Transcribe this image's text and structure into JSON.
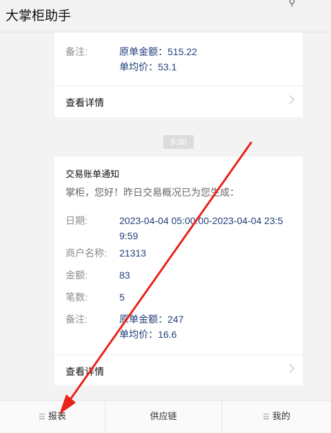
{
  "header": {
    "title": "大掌柜助手",
    "pin_icon": "pin-icon"
  },
  "first_card": {
    "note_label": "备注:",
    "note_lines": [
      "原单金额：515.22",
      "单均价：53.1"
    ],
    "detail_label": "查看详情"
  },
  "timestamp": "9:30",
  "second_card": {
    "title": "交易账单通知",
    "greeting": "掌柜，您好！昨日交易概况已为您生成：",
    "fields": [
      {
        "label": "日期:",
        "value": "2023-04-04 05:00:00-2023-04-04 23:5\n9:59"
      },
      {
        "label": "商户名称:",
        "value": "21313"
      },
      {
        "label": "金额:",
        "value": "83"
      },
      {
        "label": "笔数:",
        "value": "5"
      },
      {
        "label": "备注:",
        "value": "原单金额：247\n单均价：16.6"
      }
    ],
    "detail_label": "查看详情"
  },
  "tabbar": {
    "tabs": [
      {
        "label": "报表",
        "icon": "menu-icon"
      },
      {
        "label": "供应链",
        "icon": ""
      },
      {
        "label": "我的",
        "icon": "menu-icon"
      }
    ]
  },
  "colors": {
    "annotation_arrow": "#e8231a",
    "value_text": "#1f3f7a"
  }
}
